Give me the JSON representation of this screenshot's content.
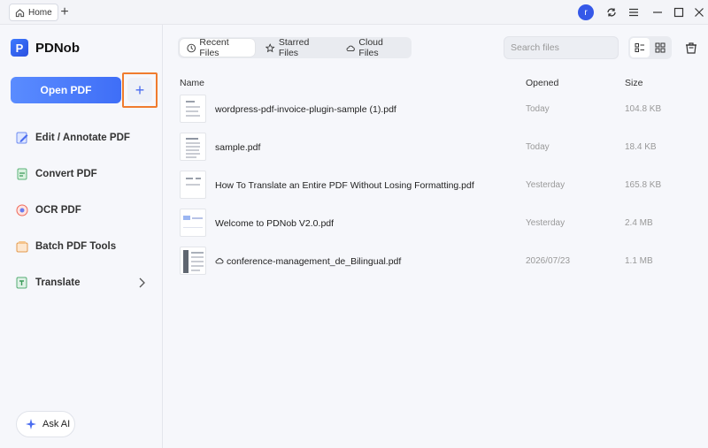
{
  "titlebar": {
    "home_tab": "Home",
    "new_tab": "+",
    "avatar_letter": "r"
  },
  "sidebar": {
    "app_name": "PDNob",
    "logo_letter": "P",
    "open_button": "Open PDF",
    "add_button": "+",
    "items": [
      {
        "label": "Edit / Annotate PDF",
        "icon": "edit-icon"
      },
      {
        "label": "Convert PDF",
        "icon": "convert-icon"
      },
      {
        "label": "OCR PDF",
        "icon": "ocr-icon"
      },
      {
        "label": "Batch PDF Tools",
        "icon": "batch-icon"
      },
      {
        "label": "Translate",
        "icon": "translate-icon"
      }
    ],
    "ask_ai": "Ask AI"
  },
  "main": {
    "tabs": [
      {
        "label": "Recent Files",
        "icon": "clock-icon",
        "active": true
      },
      {
        "label": "Starred Files",
        "icon": "star-icon",
        "active": false
      },
      {
        "label": "Cloud Files",
        "icon": "cloud-icon",
        "active": false
      }
    ],
    "search_placeholder": "Search files",
    "columns": {
      "name": "Name",
      "opened": "Opened",
      "size": "Size"
    },
    "files": [
      {
        "name": "wordpress-pdf-invoice-plugin-sample (1).pdf",
        "opened": "Today",
        "size": "104.8 KB",
        "cloud": false
      },
      {
        "name": "sample.pdf",
        "opened": "Today",
        "size": "18.4 KB",
        "cloud": false
      },
      {
        "name": "How To Translate an Entire PDF Without Losing Formatting.pdf",
        "opened": "Yesterday",
        "size": "165.8 KB",
        "cloud": false
      },
      {
        "name": "Welcome to PDNob V2.0.pdf",
        "opened": "Yesterday",
        "size": "2.4 MB",
        "cloud": false
      },
      {
        "name": "conference-management_de_Bilingual.pdf",
        "opened": "2026/07/23",
        "size": "1.1 MB",
        "cloud": true
      }
    ]
  },
  "colors": {
    "accent": "#3f6ef7",
    "highlight": "#f07c2e"
  }
}
